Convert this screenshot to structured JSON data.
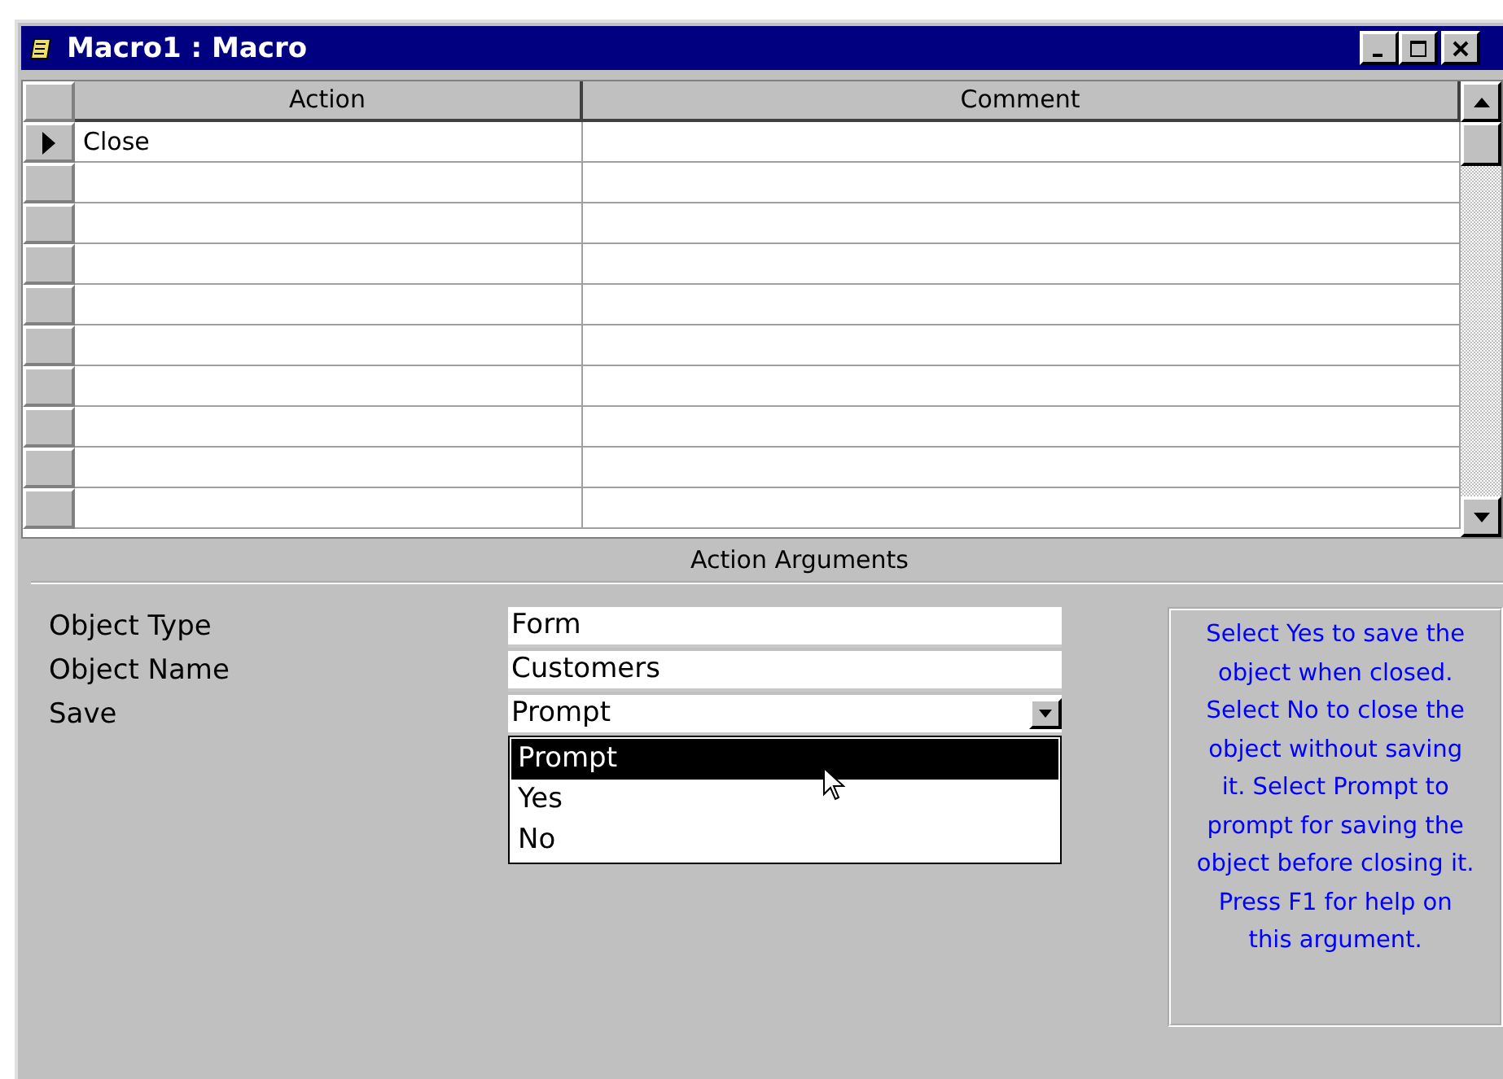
{
  "window": {
    "title": "Macro1 : Macro"
  },
  "grid": {
    "columns": [
      "Action",
      "Comment"
    ],
    "rows": [
      {
        "action": "Close",
        "selected": true
      },
      {
        "selected": false
      },
      {
        "selected": false
      },
      {
        "selected": false
      },
      {
        "selected": false
      },
      {
        "selected": false
      },
      {
        "selected": false
      },
      {
        "selected": false
      },
      {
        "selected": false
      },
      {
        "selected": false
      }
    ]
  },
  "arguments": {
    "title": "Action Arguments",
    "fields": [
      {
        "kind": "text",
        "label": "Object Type",
        "value": "Form"
      },
      {
        "kind": "text",
        "label": "Object Name",
        "value": "Customers"
      },
      {
        "kind": "dropdown",
        "label": "Save",
        "value": "Prompt",
        "expanded": true,
        "options": [
          {
            "label": "Prompt",
            "selected": true
          },
          {
            "label": "Yes",
            "selected": false
          },
          {
            "label": "No",
            "selected": false
          }
        ]
      }
    ],
    "help": "Select Yes to save the object when closed. Select No to close the object without saving it. Select Prompt to prompt for saving the object before closing it. Press F1 for help on this argument."
  }
}
